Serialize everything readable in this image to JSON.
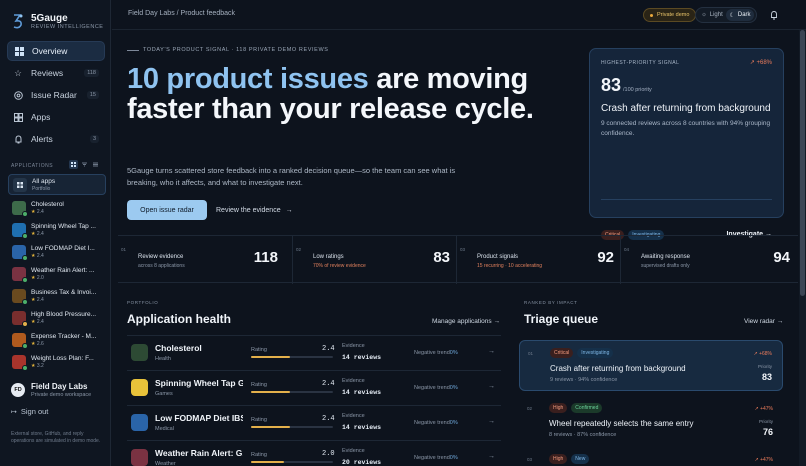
{
  "colors": {
    "accent": "#8fc3f0",
    "background": "#0d131d",
    "warning": "#e3b04b",
    "danger": "#ec7c5b"
  },
  "brand": {
    "name": "5Gauge",
    "tagline": "REVIEW INTELLIGENCE"
  },
  "nav": [
    {
      "label": "Overview",
      "icon": "grid-icon",
      "active": true
    },
    {
      "label": "Reviews",
      "icon": "star-icon",
      "count": "118"
    },
    {
      "label": "Issue Radar",
      "icon": "radar-icon",
      "count": "15"
    },
    {
      "label": "Apps",
      "icon": "apps-icon"
    },
    {
      "label": "Alerts",
      "icon": "bell-icon",
      "count": "3"
    }
  ],
  "sidebar_apps": {
    "heading": "APPLICATIONS",
    "all": {
      "name": "All apps",
      "sub": "Portfolio"
    },
    "items": [
      {
        "name": "Cholesterol",
        "rating": "2.4"
      },
      {
        "name": "Spinning Wheel Tap ...",
        "rating": "2.4"
      },
      {
        "name": "Low FODMAP Diet I...",
        "rating": "2.4"
      },
      {
        "name": "Weather Rain Alert: ...",
        "rating": "2.0"
      },
      {
        "name": "Business Tax & Invoi...",
        "rating": "2.4"
      },
      {
        "name": "High Blood Pressure...",
        "rating": "2.4"
      },
      {
        "name": "Expense Tracker - M...",
        "rating": "2.6"
      },
      {
        "name": "Weight Loss Plan: F...",
        "rating": "3.2"
      }
    ]
  },
  "user": {
    "initials": "FD",
    "name": "Field Day Labs",
    "sub": "Private demo workspace"
  },
  "sign_out": "Sign out",
  "footer_note": "External store, GitHub, and reply operations are simulated in demo mode.",
  "topbar": {
    "breadcrumb": "Field Day Labs / Product feedback",
    "demo_pill": "Private demo",
    "theme_light": "Light",
    "theme_dark": "Dark"
  },
  "hero": {
    "eyebrow": "TODAY'S PRODUCT SIGNAL · 118 PRIVATE DEMO REVIEWS",
    "headline_highlight": "10 product issues",
    "headline_rest": " are moving faster than your release cycle.",
    "lede": "5Gauge turns scattered store feedback into a ranked decision queue—so the team can see what is breaking, who it affects, and what to investigate next.",
    "primary_button": "Open issue radar",
    "secondary_button": "Review the evidence"
  },
  "signal_card": {
    "heading": "HIGHEST-PRIORITY SIGNAL",
    "delta": "+68%",
    "score": "83",
    "unit": "/100 priority",
    "title": "Crash after returning from background",
    "description": "9 connected reviews across 8 countries with 94% grouping confidence.",
    "tags": [
      "Critical",
      "Investigating"
    ],
    "link": "Investigate"
  },
  "stats": [
    {
      "num": "01",
      "label": "Review evidence",
      "sub": "across 8 applications",
      "value": "118",
      "warn": false
    },
    {
      "num": "02",
      "label": "Low ratings",
      "sub": "70% of review evidence",
      "value": "83",
      "warn": true
    },
    {
      "num": "03",
      "label": "Product signals",
      "sub": "15 recurring · 10 accelerating",
      "value": "92",
      "warn": true
    },
    {
      "num": "04",
      "label": "Awaiting response",
      "sub": "supervised drafts only",
      "value": "94",
      "warn": false
    }
  ],
  "portfolio": {
    "eyebrow": "PORTFOLIO",
    "title": "Application health",
    "link": "Manage applications",
    "rating_label": "Rating",
    "evidence_label": "Evidence",
    "trend_label": "Negative trend",
    "rows": [
      {
        "name": "Cholesterol",
        "category": "Health",
        "rating": "2.4",
        "rating_fraction": 0.48,
        "evidence": "14 reviews",
        "trend": "0%"
      },
      {
        "name": "Spinning Wheel Tap Game",
        "category": "Games",
        "rating": "2.4",
        "rating_fraction": 0.48,
        "evidence": "14 reviews",
        "trend": "0%"
      },
      {
        "name": "Low FODMAP Diet IBS",
        "category": "Medical",
        "rating": "2.4",
        "rating_fraction": 0.48,
        "evidence": "14 reviews",
        "trend": "0%"
      },
      {
        "name": "Weather Rain Alert: G...",
        "category": "Weather",
        "rating": "2.0",
        "rating_fraction": 0.4,
        "evidence": "20 reviews",
        "trend": "0%"
      }
    ]
  },
  "triage": {
    "eyebrow": "RANKED BY IMPACT",
    "title": "Triage queue",
    "link": "View radar",
    "priority_label": "Priority",
    "items": [
      {
        "num": "01",
        "tags": [
          "Critical",
          "Investigating"
        ],
        "title": "Crash after returning from background",
        "sub": "9 reviews · 94% confidence",
        "delta": "+68%",
        "priority": "83"
      },
      {
        "num": "02",
        "tags": [
          "High",
          "Confirmed"
        ],
        "title": "Wheel repeatedly selects the same entry",
        "sub": "8 reviews · 87% confidence",
        "delta": "+47%",
        "priority": "76"
      },
      {
        "num": "03",
        "tags": [
          "High",
          "New"
        ],
        "title": "",
        "sub": "",
        "delta": "+47%",
        "priority": ""
      }
    ]
  }
}
